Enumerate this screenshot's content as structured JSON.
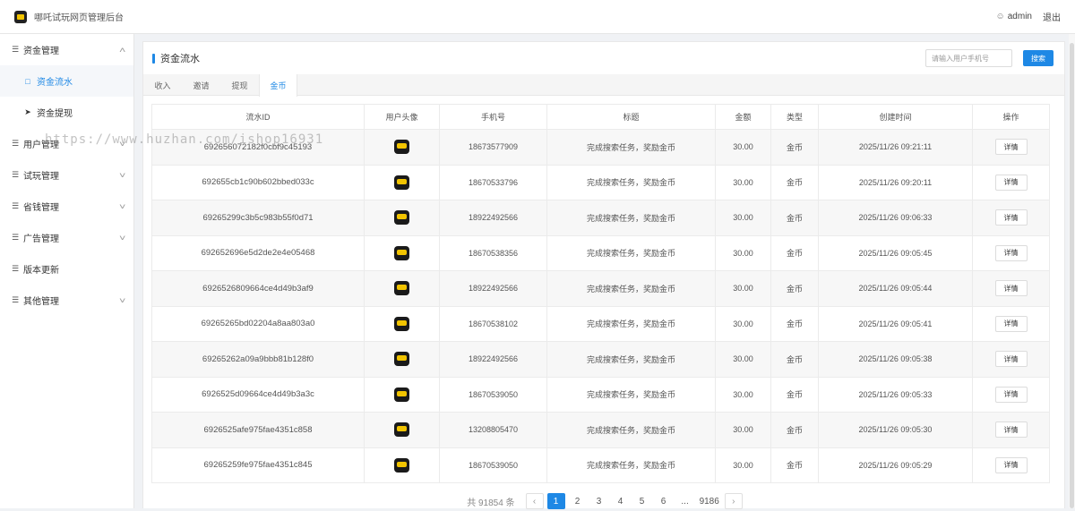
{
  "header": {
    "app_title": "哪吒试玩网页管理后台",
    "username": "admin",
    "logout": "退出"
  },
  "sidebar": {
    "items": [
      {
        "label": "资金管理",
        "expanded": true,
        "icon": "list-icon"
      },
      {
        "label": "用户管理",
        "icon": "list-icon"
      },
      {
        "label": "试玩管理",
        "icon": "list-icon"
      },
      {
        "label": "省钱管理",
        "icon": "list-icon"
      },
      {
        "label": "广告管理",
        "icon": "list-icon"
      },
      {
        "label": "版本更新",
        "icon": "list-icon"
      },
      {
        "label": "其他管理",
        "icon": "list-icon"
      }
    ],
    "sub_items": [
      {
        "label": "资金流水",
        "active": true,
        "icon": "map-icon"
      },
      {
        "label": "资金提现",
        "icon": "send-icon"
      }
    ]
  },
  "watermark": "https://www.huzhan.com/ishop16931",
  "panel": {
    "title": "资金流水",
    "search_placeholder": "请输入用户手机号",
    "search_button": "搜索"
  },
  "tabs": [
    {
      "label": "收入"
    },
    {
      "label": "邀请"
    },
    {
      "label": "提现"
    },
    {
      "label": "金币",
      "active": true
    }
  ],
  "table": {
    "columns": [
      "流水ID",
      "用户头像",
      "手机号",
      "标题",
      "金额",
      "类型",
      "创建时间",
      "操作"
    ],
    "action_label": "详情",
    "rows": [
      {
        "id": "692656072182f0cbf9c45193",
        "phone": "18673577909",
        "title": "完成搜索任务，奖励金币",
        "amount": "30.00",
        "type": "金币",
        "created": "2025/11/26 09:21:11"
      },
      {
        "id": "692655cb1c90b602bbed033c",
        "phone": "18670533796",
        "title": "完成搜索任务，奖励金币",
        "amount": "30.00",
        "type": "金币",
        "created": "2025/11/26 09:20:11"
      },
      {
        "id": "69265299c3b5c983b55f0d71",
        "phone": "18922492566",
        "title": "完成搜索任务，奖励金币",
        "amount": "30.00",
        "type": "金币",
        "created": "2025/11/26 09:06:33"
      },
      {
        "id": "692652696e5d2de2e4e05468",
        "phone": "18670538356",
        "title": "完成搜索任务，奖励金币",
        "amount": "30.00",
        "type": "金币",
        "created": "2025/11/26 09:05:45"
      },
      {
        "id": "6926526809664ce4d49b3af9",
        "phone": "18922492566",
        "title": "完成搜索任务，奖励金币",
        "amount": "30.00",
        "type": "金币",
        "created": "2025/11/26 09:05:44"
      },
      {
        "id": "69265265bd02204a8aa803a0",
        "phone": "18670538102",
        "title": "完成搜索任务，奖励金币",
        "amount": "30.00",
        "type": "金币",
        "created": "2025/11/26 09:05:41"
      },
      {
        "id": "69265262a09a9bbb81b128f0",
        "phone": "18922492566",
        "title": "完成搜索任务，奖励金币",
        "amount": "30.00",
        "type": "金币",
        "created": "2025/11/26 09:05:38"
      },
      {
        "id": "6926525d09664ce4d49b3a3c",
        "phone": "18670539050",
        "title": "完成搜索任务，奖励金币",
        "amount": "30.00",
        "type": "金币",
        "created": "2025/11/26 09:05:33"
      },
      {
        "id": "6926525afe975fae4351c858",
        "phone": "13208805470",
        "title": "完成搜索任务，奖励金币",
        "amount": "30.00",
        "type": "金币",
        "created": "2025/11/26 09:05:30"
      },
      {
        "id": "69265259fe975fae4351c845",
        "phone": "18670539050",
        "title": "完成搜索任务，奖励金币",
        "amount": "30.00",
        "type": "金币",
        "created": "2025/11/26 09:05:29"
      }
    ]
  },
  "pagination": {
    "total_text": "共 91854 条",
    "pages": [
      "1",
      "2",
      "3",
      "4",
      "5",
      "6",
      "...",
      "9186"
    ],
    "current": "1"
  }
}
